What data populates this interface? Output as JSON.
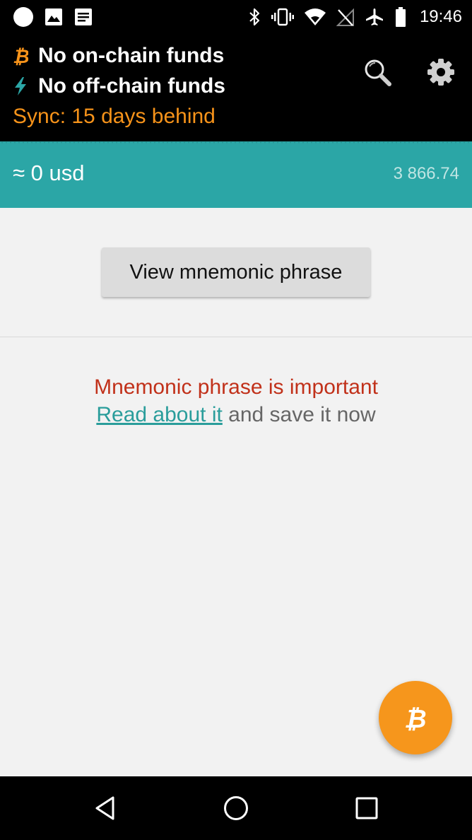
{
  "status_bar": {
    "time": "19:46",
    "left_icons": [
      "circle-icon",
      "image-icon",
      "notes-icon"
    ],
    "right_icons": [
      "bluetooth-icon",
      "vibrate-icon",
      "wifi-icon",
      "no-signal-icon",
      "airplane-icon",
      "battery-icon"
    ]
  },
  "header": {
    "onchain_label": "No on-chain funds",
    "offchain_label": "No off-chain funds",
    "sync_label": "Sync: 15 days behind",
    "icons": [
      "bitcoin-icon",
      "lightning-icon",
      "search-icon",
      "gear-icon"
    ]
  },
  "balance_band": {
    "fiat_balance": "≈ 0 usd",
    "exchange_rate": "3 866.74"
  },
  "main": {
    "mnemonic_button_label": "View mnemonic phrase",
    "warning_text": "Mnemonic phrase is important",
    "read_link_text": "Read about it",
    "read_rest_text": "and save it now"
  },
  "fab": {
    "icon": "bitcoin-icon"
  },
  "nav_bar": {
    "icons": [
      "back-icon",
      "home-icon",
      "recents-icon"
    ]
  },
  "colors": {
    "bitcoin_orange": "#f7931a",
    "teal": "#2ba6a6",
    "warning_red": "#c1311a",
    "link_teal": "#2a9d9b",
    "fab_orange": "#f6961c"
  }
}
